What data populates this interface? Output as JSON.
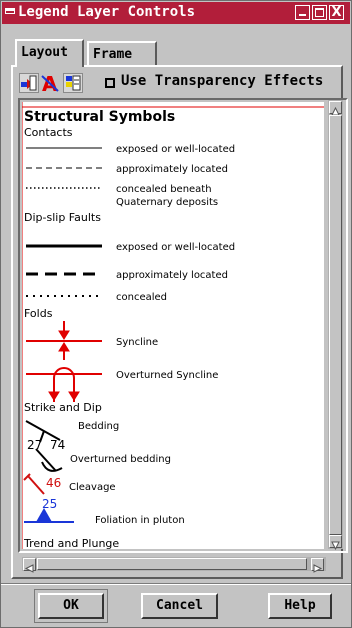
{
  "window": {
    "title": "Legend Layer Controls",
    "controls": {
      "minimize": "",
      "maximize": "",
      "close": "X"
    }
  },
  "tabs": [
    {
      "label": "Layout",
      "selected": true
    },
    {
      "label": "Frame",
      "selected": false
    }
  ],
  "toolbar": {
    "icons": [
      "add-legend-item-icon",
      "text-style-icon",
      "color-palette-icon"
    ],
    "transparency_label": "Use Transparency Effects",
    "transparency_checked": false
  },
  "legend": {
    "title": "Structural Symbols",
    "sections": {
      "contacts": {
        "heading": "Contacts",
        "items": [
          "exposed or well-located",
          "approximately located",
          "concealed beneath",
          "Quaternary deposits"
        ]
      },
      "faults": {
        "heading": "Dip-slip Faults",
        "items": [
          "exposed or well-located",
          "approximately located",
          "concealed"
        ]
      },
      "folds": {
        "heading": "Folds",
        "items": [
          "Syncline",
          "Overturned Syncline"
        ]
      },
      "strike": {
        "heading": "Strike and Dip",
        "items": [
          "Bedding",
          "Overturned bedding",
          "Cleavage",
          "Foliation in pluton"
        ],
        "numbers": [
          "27",
          "74",
          "46",
          "25"
        ]
      },
      "trend": {
        "heading": "Trend and Plunge"
      }
    }
  },
  "buttons": {
    "ok": "OK",
    "cancel": "Cancel",
    "help": "Help"
  },
  "colors": {
    "titlebar": "#b21e3a",
    "fold_symbols": "#e00000",
    "cleavage": "#d01010",
    "foliation": "#1a36d8"
  }
}
